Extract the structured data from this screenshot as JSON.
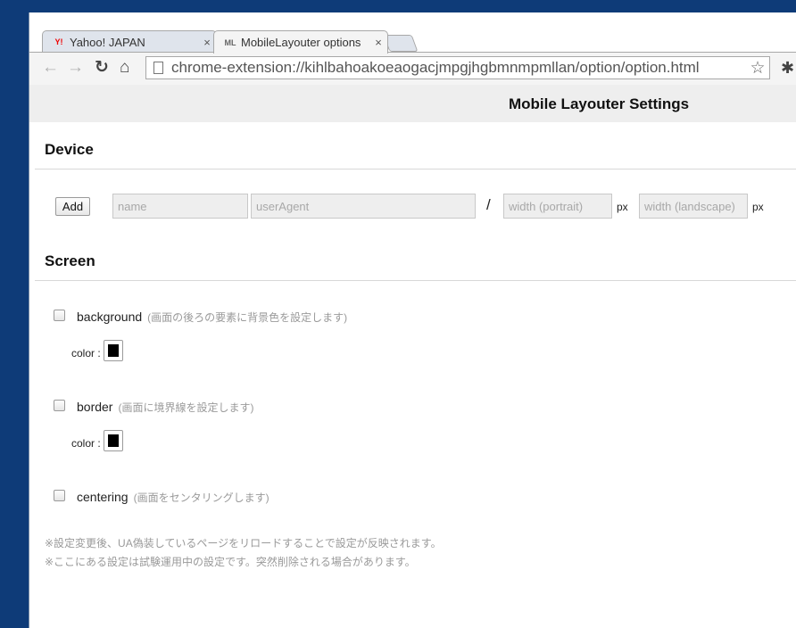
{
  "tabs": [
    {
      "label": "Yahoo! JAPAN",
      "favicon": "Y!",
      "close": "×"
    },
    {
      "label": "MobileLayouter options",
      "favicon": "ML",
      "close": "×"
    }
  ],
  "toolbar": {
    "back": "←",
    "forward": "→",
    "reload": "↻",
    "home": "⌂",
    "url": "chrome-extension://kihlbahoakoeaogacjmpgjhgbmnmpmllan/option/option.html",
    "star": "☆"
  },
  "page": {
    "title": "Mobile Layouter Settings"
  },
  "device": {
    "heading": "Device",
    "add_label": "Add",
    "name_placeholder": "name",
    "ua_placeholder": "userAgent",
    "slash": "/",
    "portrait_placeholder": "width (portrait)",
    "landscape_placeholder": "width (landscape)",
    "unit": "px"
  },
  "screen": {
    "heading": "Screen",
    "background": {
      "label": "background",
      "desc": "(画面の後ろの要素に背景色を設定します)",
      "color_label": "color :",
      "color": "#000000"
    },
    "border": {
      "label": "border",
      "desc": "(画面に境界線を設定します)",
      "color_label": "color :",
      "color": "#000000"
    },
    "centering": {
      "label": "centering",
      "desc": "(画面をセンタリングします)"
    }
  },
  "notes": [
    "※設定変更後、UA偽装しているページをリロードすることで設定が反映されます。",
    "※ここにある設定は試験運用中の設定です。突然削除される場合があります。"
  ]
}
